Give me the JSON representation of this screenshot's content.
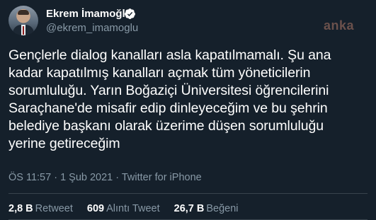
{
  "author": {
    "display_name": "Ekrem İmamoğlu",
    "handle": "@ekrem_imamoglu",
    "verified": true,
    "avatar": "profile-photo"
  },
  "watermark": "anka",
  "tweet": {
    "lines": [
      "Gençlerle dialog kanalları asla kapatılmamalı. Şu ana",
      "kadar kapatılmış kanalları açmak tüm yöneticilerin",
      "sorumluluğu. Yarın Boğaziçi Üniversitesi öğrencilerini",
      "Saraçhane'de misafir edip dinleyeceğim ve bu şehrin",
      "belediye başkanı olarak üzerime düşen sorumluluğu",
      "yerine getireceğim"
    ],
    "meta": "ÖS 11:57 · 1 Şub 2021 · Twitter for iPhone"
  },
  "stats": {
    "retweets": {
      "count": "2,8 B",
      "label": "Retweet"
    },
    "quotes": {
      "count": "609",
      "label": "Alıntı Tweet"
    },
    "likes": {
      "count": "26,7 B",
      "label": "Beğeni"
    }
  },
  "colors": {
    "background": "#15202b",
    "verified_badge": "#ffffff",
    "muted_text": "#8899a6",
    "divider": "#38444d"
  }
}
